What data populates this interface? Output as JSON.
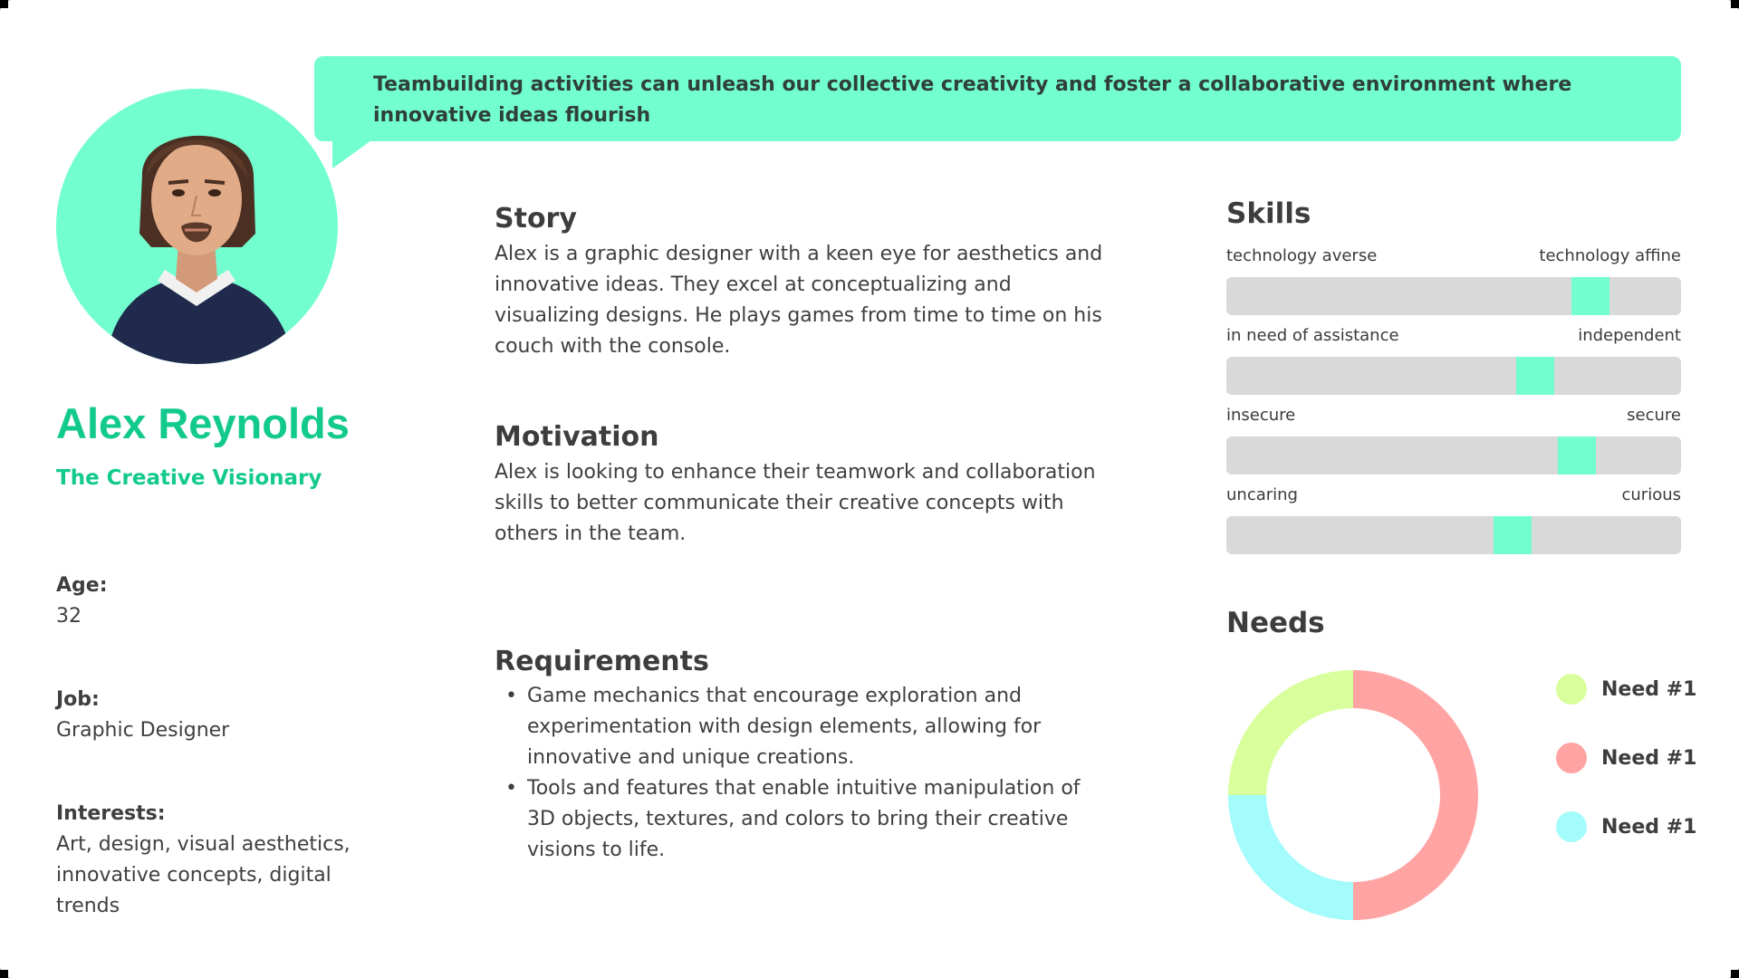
{
  "quote": "Teambuilding activities can unleash our collective creativity and foster a collaborative environment where innovative ideas flourish",
  "persona": {
    "name": "Alex Reynolds",
    "tagline": "The Creative Visionary",
    "age_label": "Age:",
    "age": "32",
    "job_label": "Job:",
    "job": "Graphic Designer",
    "interests_label": "Interests:",
    "interests": "Art, design, visual aesthetics, innovative concepts, digital trends"
  },
  "story": {
    "title": "Story",
    "text": "Alex is a graphic designer with a keen eye for aesthetics and innovative ideas. They excel at conceptualizing and visualizing designs. He plays games from time to time on his couch with the console."
  },
  "motivation": {
    "title": "Motivation",
    "text": "Alex is looking to enhance their teamwork and collaboration skills to better communicate their creative concepts with others in the team."
  },
  "requirements": {
    "title": "Requirements",
    "items": [
      "Game mechanics that encourage exploration and experimentation with design elements, allowing for innovative and unique creations.",
      "Tools and features that enable intuitive manipulation of 3D objects, textures, and colors to bring their creative visions to life."
    ]
  },
  "skills": {
    "title": "Skills",
    "items": [
      {
        "left": "technology averse",
        "right": "technology affine",
        "level": 0.8
      },
      {
        "left": "in need of assistance",
        "right": "independent",
        "level": 0.68
      },
      {
        "left": "insecure",
        "right": "secure",
        "level": 0.77
      },
      {
        "left": "uncaring",
        "right": "curious",
        "level": 0.63
      }
    ]
  },
  "needs": {
    "title": "Needs",
    "items": [
      {
        "label": "Need #1",
        "color": "#d9fe9c",
        "share": 25
      },
      {
        "label": "Need #1",
        "color": "#ffa3a3",
        "share": 50
      },
      {
        "label": "Need #1",
        "color": "#a3fbfc",
        "share": 25
      }
    ]
  },
  "colors": {
    "accent": "#72fecf",
    "accent_text": "#12c98e",
    "track": "#d9d9d9"
  }
}
